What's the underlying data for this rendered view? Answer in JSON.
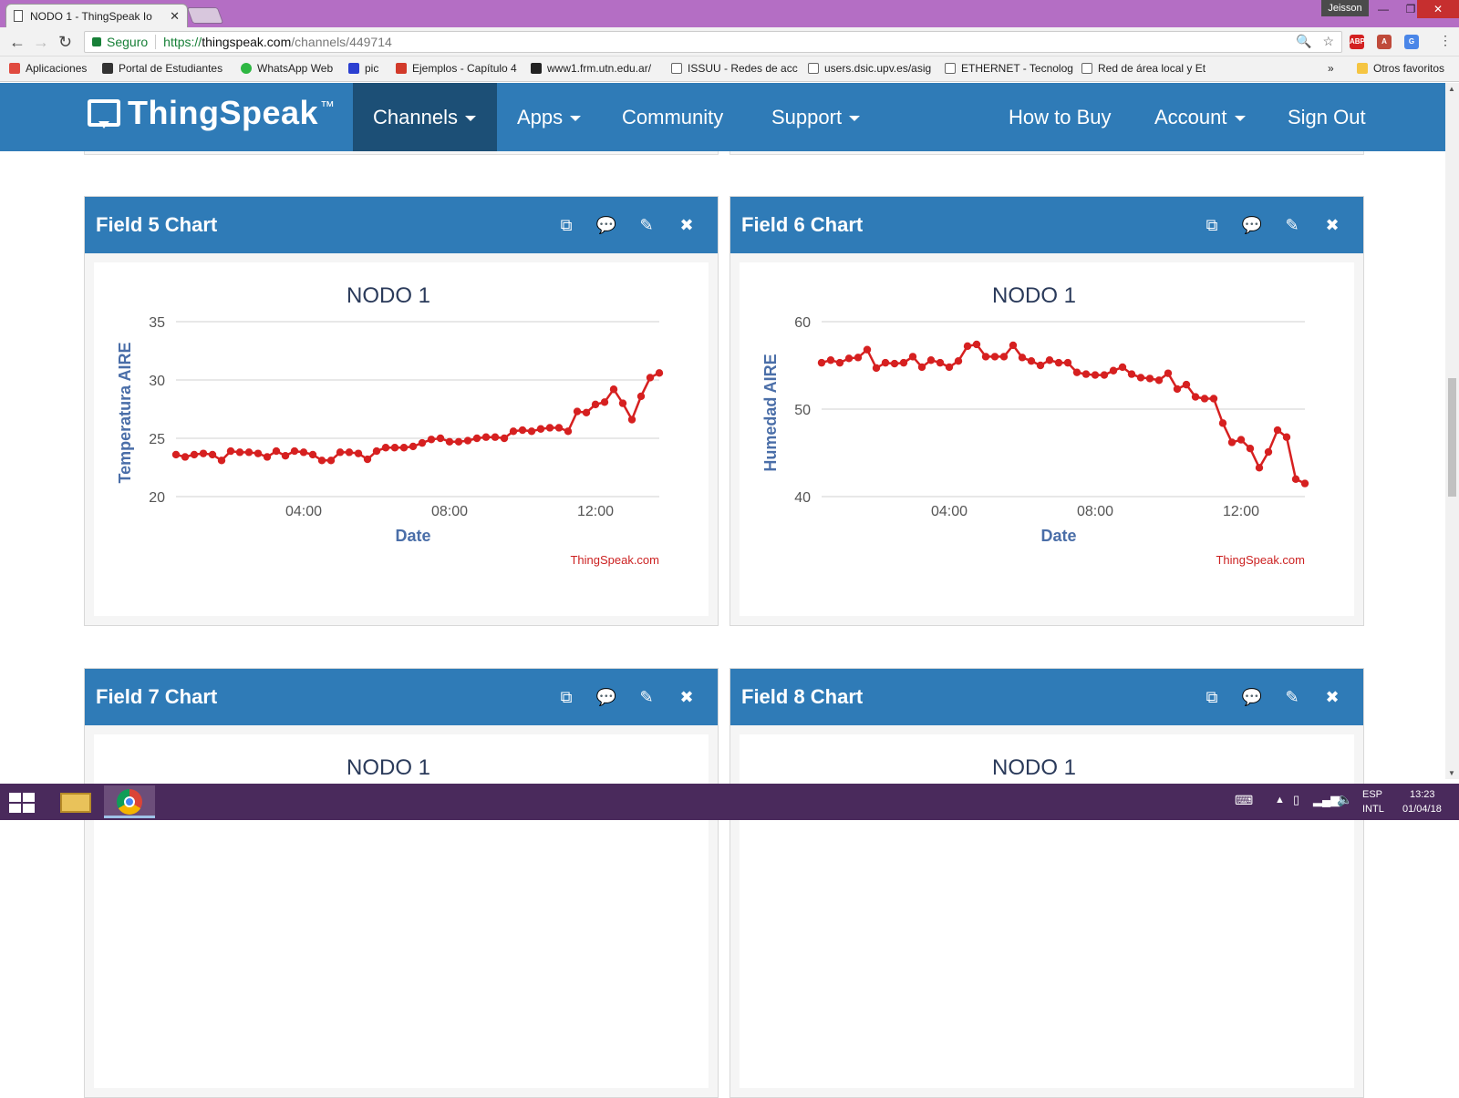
{
  "browser": {
    "tab_title": "NODO 1 - ThingSpeak Io",
    "tab_close": "✕",
    "user": "Jeisson",
    "secure_label": "Seguro",
    "url_scheme": "https://",
    "url_host": "thingspeak.com",
    "url_path": "/channels/449714",
    "bookmarks": [
      {
        "label": "Aplicaciones",
        "color": "#e04a3f"
      },
      {
        "label": "Portal de Estudiantes",
        "color": "#333333"
      },
      {
        "label": "WhatsApp Web",
        "color": "#2db742"
      },
      {
        "label": "pic",
        "color": "#2b3fd1"
      },
      {
        "label": "Ejemplos - Capítulo 4",
        "color": "#d23a2a"
      },
      {
        "label": "www1.frm.utn.edu.ar/",
        "color": "#222222"
      },
      {
        "label": "ISSUU - Redes de acc",
        "color": "#666666"
      },
      {
        "label": "users.dsic.upv.es/asig",
        "color": "#666666"
      },
      {
        "label": "ETHERNET - Tecnolog",
        "color": "#666666"
      },
      {
        "label": "Red de área local y Et",
        "color": "#666666"
      }
    ],
    "bookmarks_more": "»",
    "other_bookmarks": "Otros favoritos"
  },
  "nav": {
    "logo": "ThingSpeak",
    "logo_tm": "™",
    "channels": "Channels",
    "apps": "Apps",
    "community": "Community",
    "support": "Support",
    "how_to_buy": "How to Buy",
    "account": "Account",
    "sign_out": "Sign Out"
  },
  "panels": [
    {
      "title": "Field 5 Chart"
    },
    {
      "title": "Field 6 Chart"
    },
    {
      "title": "Field 7 Chart"
    },
    {
      "title": "Field 8 Chart"
    }
  ],
  "panel_icons": {
    "open": "⧉",
    "comment": "💬",
    "edit": "✎",
    "close": "✖"
  },
  "chart_data": [
    {
      "type": "line",
      "title": "NODO 1",
      "xlabel": "Date",
      "ylabel": "Temperatura AIRE",
      "credit": "ThingSpeak.com",
      "color": "#d62020",
      "x_ticks": [
        "04:00",
        "08:00",
        "12:00"
      ],
      "y_ticks": [
        20,
        25,
        30,
        35
      ],
      "xlim": [
        "00:30",
        "13:45"
      ],
      "ylim": [
        20,
        35
      ],
      "grid": true,
      "x": [
        "00:30",
        "00:45",
        "01:00",
        "01:15",
        "01:30",
        "01:45",
        "02:00",
        "02:15",
        "02:30",
        "02:45",
        "03:00",
        "03:15",
        "03:30",
        "03:45",
        "04:00",
        "04:15",
        "04:30",
        "04:45",
        "05:00",
        "05:15",
        "05:30",
        "05:45",
        "06:00",
        "06:15",
        "06:30",
        "06:45",
        "07:00",
        "07:15",
        "07:30",
        "07:45",
        "08:00",
        "08:15",
        "08:30",
        "08:45",
        "09:00",
        "09:15",
        "09:30",
        "09:45",
        "10:00",
        "10:15",
        "10:30",
        "10:45",
        "11:00",
        "11:15",
        "11:30",
        "11:45",
        "12:00",
        "12:15",
        "12:30",
        "12:45",
        "13:00",
        "13:15",
        "13:30",
        "13:45"
      ],
      "values": [
        23.6,
        23.4,
        23.6,
        23.7,
        23.6,
        23.1,
        23.9,
        23.8,
        23.8,
        23.7,
        23.4,
        23.9,
        23.5,
        23.9,
        23.8,
        23.6,
        23.1,
        23.1,
        23.8,
        23.8,
        23.7,
        23.2,
        23.9,
        24.2,
        24.2,
        24.2,
        24.3,
        24.6,
        24.9,
        25.0,
        24.7,
        24.7,
        24.8,
        25.0,
        25.1,
        25.1,
        25.0,
        25.6,
        25.7,
        25.6,
        25.8,
        25.9,
        25.9,
        25.6,
        27.3,
        27.2,
        27.9,
        28.1,
        29.2,
        28.0,
        26.6,
        28.6,
        30.2,
        30.6
      ]
    },
    {
      "type": "line",
      "title": "NODO 1",
      "xlabel": "Date",
      "ylabel": "Humedad AIRE",
      "credit": "ThingSpeak.com",
      "color": "#d62020",
      "x_ticks": [
        "04:00",
        "08:00",
        "12:00"
      ],
      "y_ticks": [
        40,
        50,
        60
      ],
      "xlim": [
        "00:30",
        "13:45"
      ],
      "ylim": [
        40,
        60
      ],
      "grid": true,
      "x": [
        "00:30",
        "00:45",
        "01:00",
        "01:15",
        "01:30",
        "01:45",
        "02:00",
        "02:15",
        "02:30",
        "02:45",
        "03:00",
        "03:15",
        "03:30",
        "03:45",
        "04:00",
        "04:15",
        "04:30",
        "04:45",
        "05:00",
        "05:15",
        "05:30",
        "05:45",
        "06:00",
        "06:15",
        "06:30",
        "06:45",
        "07:00",
        "07:15",
        "07:30",
        "07:45",
        "08:00",
        "08:15",
        "08:30",
        "08:45",
        "09:00",
        "09:15",
        "09:30",
        "09:45",
        "10:00",
        "10:15",
        "10:30",
        "10:45",
        "11:00",
        "11:15",
        "11:30",
        "11:45",
        "12:00",
        "12:15",
        "12:30",
        "12:45",
        "13:00",
        "13:15",
        "13:30",
        "13:45"
      ],
      "values": [
        55.3,
        55.6,
        55.3,
        55.8,
        55.9,
        56.8,
        54.7,
        55.3,
        55.2,
        55.3,
        56.0,
        54.8,
        55.6,
        55.3,
        54.8,
        55.5,
        57.2,
        57.4,
        56.0,
        56.0,
        56.0,
        57.3,
        55.9,
        55.5,
        55.0,
        55.6,
        55.3,
        55.3,
        54.2,
        54.0,
        53.9,
        53.9,
        54.4,
        54.8,
        54.0,
        53.6,
        53.5,
        53.3,
        54.1,
        52.3,
        52.8,
        51.4,
        51.2,
        51.2,
        48.4,
        46.2,
        46.5,
        45.5,
        43.3,
        45.1,
        47.6,
        46.8,
        42.0,
        41.5
      ]
    },
    {
      "type": "line",
      "title": "NODO 1"
    },
    {
      "type": "line",
      "title": "NODO 1"
    }
  ],
  "taskbar": {
    "lang_top": "ESP",
    "lang_bottom": "INTL",
    "time": "13:23",
    "date": "01/04/18"
  }
}
